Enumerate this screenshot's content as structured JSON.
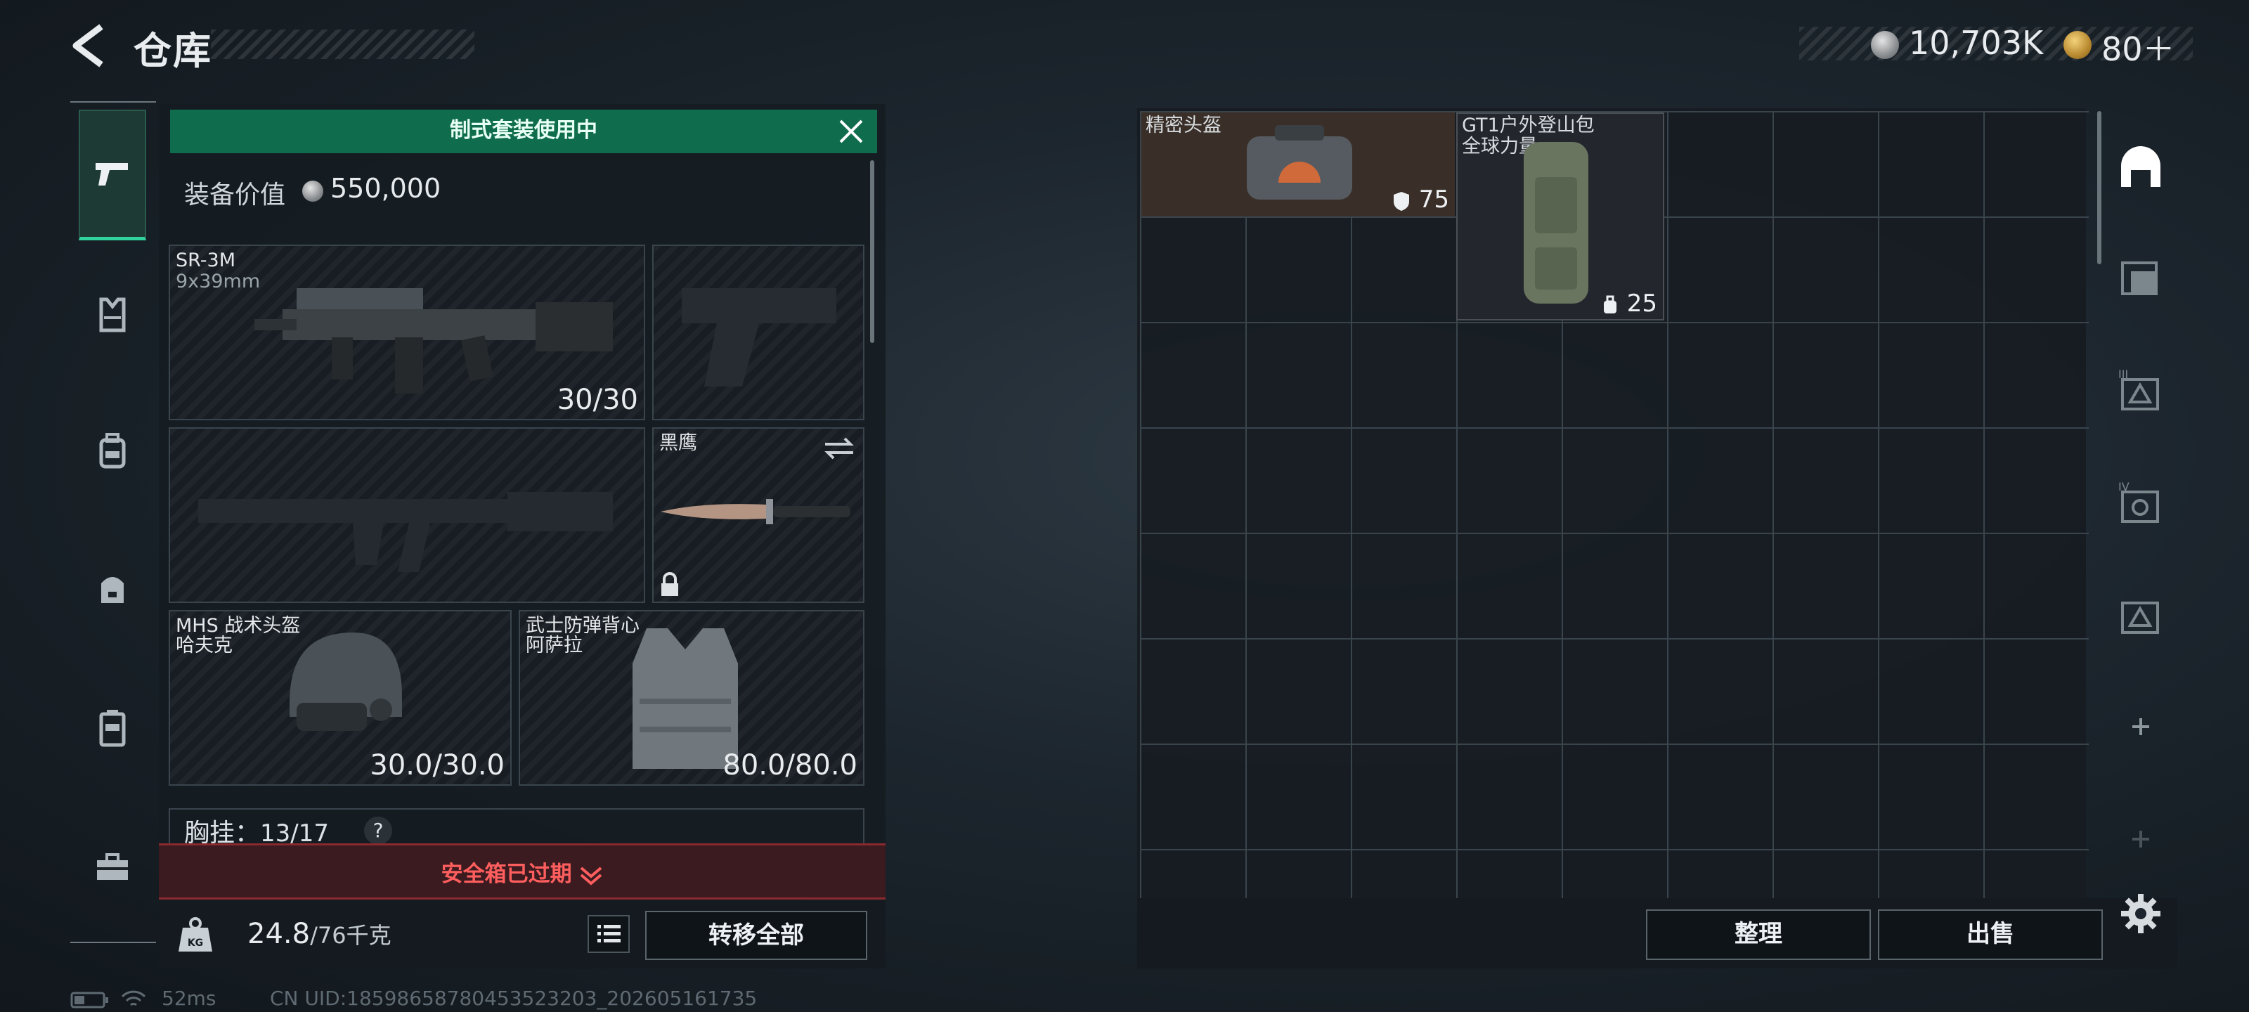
{
  "header": {
    "title": "仓库",
    "currency_silver": "10,703K",
    "currency_gold": "80＋"
  },
  "nav": {
    "items": [
      "weapon-tab",
      "vest-tab",
      "backpack-tab",
      "bag-tab",
      "case-tab",
      "toolbox-tab"
    ]
  },
  "loadout": {
    "banner": "制式套装使用中",
    "value_label": "装备价值",
    "value": "550,000",
    "primary_weapon": {
      "name": "SR-3M",
      "ammo_type": "9x39mm",
      "ammo": "30/30"
    },
    "melee": {
      "name": "黑鹰"
    },
    "helmet": {
      "name": "MHS 战术头盔",
      "brand": "哈夫克",
      "durability": "30.0/30.0"
    },
    "armor": {
      "name": "武士防弹背心",
      "brand": "阿萨拉",
      "durability": "80.0/80.0"
    },
    "chest_rig": {
      "label": "胸挂：",
      "value": "13/17",
      "help": "?"
    },
    "safe_box_status": "安全箱已过期",
    "weight": {
      "current": "24.8",
      "max": "/76千克"
    },
    "transfer_all": "转移全部"
  },
  "stash": {
    "items": [
      {
        "name": "精密头盔",
        "value": "75"
      },
      {
        "name": "GT1户外登山包",
        "brand": "全球力量",
        "value": "25"
      }
    ],
    "sort_button": "整理",
    "sell_button": "出售"
  },
  "side_tabs": [
    "main-stash-tab",
    "stash-tab-2",
    "stash-tab-III",
    "stash-tab-IV",
    "stash-tab-5",
    "add-tab",
    "add-tab-disabled"
  ],
  "status_bar": {
    "ping": "52ms",
    "uid": "CN UID:18598658780453523203_202605161735"
  },
  "colors": {
    "accent_green": "#0f6d4d",
    "alert_red": "#ff5e5e",
    "active_underline": "#2fd39b"
  }
}
